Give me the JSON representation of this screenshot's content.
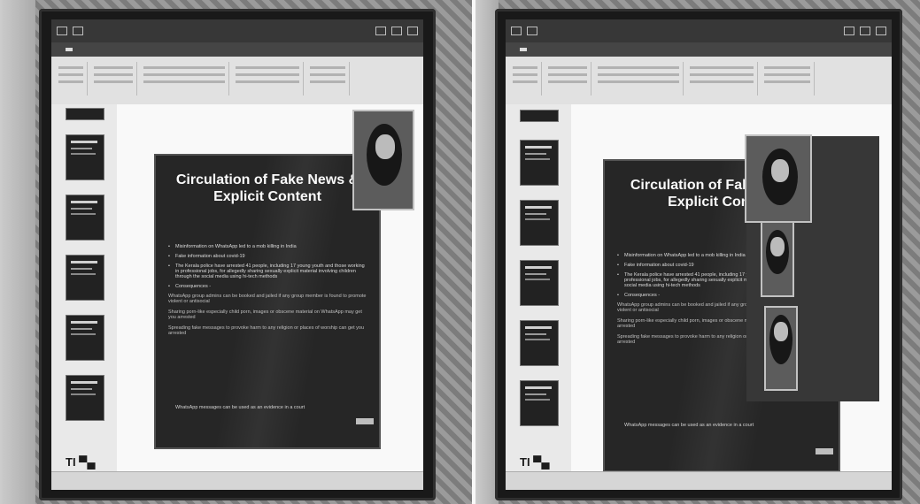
{
  "left_photo": {
    "slide": {
      "title": "Circulation of Fake News & Explicit Content",
      "bullets": [
        "Misinformation on WhatsApp led to a mob killing in India",
        "Fake information about covid-19",
        "The Kerala police have arrested 41 people, including 17 young youth and those working in professional jobs, for allegedly sharing sexually explicit material involving children through the social media using hi-tech methods",
        "Consequences -"
      ],
      "sub_lines": [
        "WhatsApp group admins can be booked and jailed if any group member is found to promote violent or antisocial",
        "Sharing porn-like especially child porn, images or obscene material on WhatsApp may get you arrested",
        "Spreading fake messages to provoke harm to any religion or places of worship can get you arrested"
      ],
      "last_line": "WhatsApp messages can be used as an evidence in a court"
    }
  },
  "right_photo": {
    "slide": {
      "title": "Circulation of Fake News & Explicit Content",
      "bullets": [
        "Misinformation on WhatsApp led to a mob killing in India",
        "Fake information about covid-19",
        "The Kerala police have arrested 41 people, including 17 young youth and those working in professional jobs, for allegedly sharing sexually explicit material involving children through the social media using hi-tech methods",
        "Consequences -"
      ],
      "sub_lines": [
        "WhatsApp group admins can be booked and jailed if any group member is found to promote violent or antisocial",
        "Sharing porn-like especially child porn, images or obscene material on WhatsApp may get you arrested",
        "Spreading fake messages to provoke harm to any religion or places of worship can get you arrested"
      ],
      "last_line": "WhatsApp messages can be used as an evidence in a court"
    }
  },
  "colors": {
    "slide_bg": "#2a2a2a",
    "slide_text": "#f4f4f4",
    "ribbon": "#dcdcdc",
    "titlebar": "#3a3a3a"
  }
}
